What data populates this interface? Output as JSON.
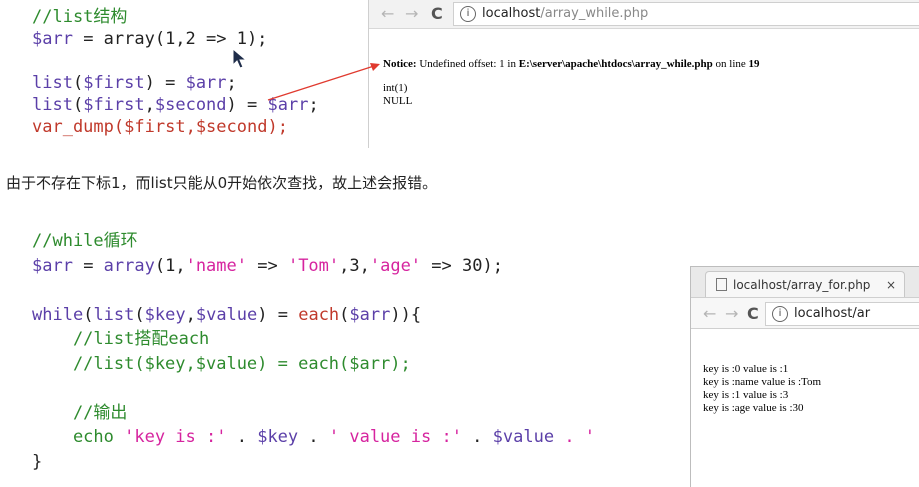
{
  "code1": {
    "line1_comment": "//list结构",
    "line2_var": "$arr",
    "line2_rest": " = array(1,2 => 1);",
    "line4_fn": "list",
    "line4_a": "(",
    "line4_var": "$first",
    "line4_b": ") = ",
    "line4_var2": "$arr",
    "line4_c": ";",
    "line5_fn": "list",
    "line5_a": "(",
    "line5_var": "$first",
    "line5_b": ",",
    "line5_var2": "$second",
    "line5_c": ") = ",
    "line5_var3": "$arr",
    "line5_d": ";",
    "line6_fn": "var_dump",
    "line6_a": "(",
    "line6_var": "$first",
    "line6_b": ",",
    "line6_var2": "$second",
    "line6_c": ");"
  },
  "browser1": {
    "url_host": "localhost",
    "url_path": "/array_while.php",
    "notice_label": "Notice:",
    "notice_text": " Undefined offset: 1 in ",
    "notice_path": "E:\\server\\apache\\htdocs\\array_while.php",
    "notice_online": " on line ",
    "notice_line": "19",
    "out1": "int(1)",
    "out2": "NULL"
  },
  "caption": "由于不存在下标1，而list只能从0开始依次查找，故上述会报错。",
  "code2": {
    "l1": "//while循环",
    "l2_var": "$arr",
    "l2_a": " = ",
    "l2_fn": "array",
    "l2_b": "(1,",
    "l2_s1": "'name'",
    "l2_c": " => ",
    "l2_s2": "'Tom'",
    "l2_d": ",3,",
    "l2_s3": "'age'",
    "l2_e": " => 30);",
    "l4_kw": "while",
    "l4_a": "(",
    "l4_fn": "list",
    "l4_b": "(",
    "l4_v1": "$key",
    "l4_c": ",",
    "l4_v2": "$value",
    "l4_d": ") = ",
    "l4_fn2": "each",
    "l4_e": "(",
    "l4_v3": "$arr",
    "l4_f": ")){",
    "l5": "    //list搭配each",
    "l6": "    //list($key,$value) = each($arr);",
    "l8": "    //输出",
    "l9_kw": "    echo ",
    "l9_s1": "'key is :'",
    "l9_a": " . ",
    "l9_v1": "$key",
    "l9_b": " . ",
    "l9_s2": "' value is :'",
    "l9_c": " . ",
    "l9_v2": "$value",
    "l9_d": " . '",
    "l10": "}"
  },
  "browser2": {
    "tab_title": "localhost/array_for.php",
    "tab_close": "×",
    "url_host": "localhost/ar",
    "rows": [
      "key is :0 value is :1",
      "key is :name value is :Tom",
      "key is :1 value is :3",
      "key is :age value is :30"
    ]
  },
  "icons": {
    "back": "←",
    "forward": "→",
    "reload": "C",
    "info": "i"
  }
}
